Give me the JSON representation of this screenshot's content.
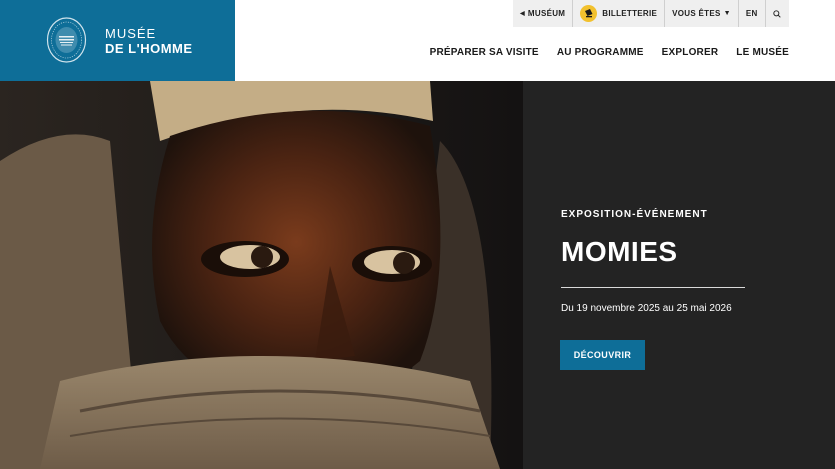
{
  "header": {
    "logo": {
      "line1": "MUSÉE",
      "line2": "DE L'HOMME",
      "seal_icon": "museum-seal-icon",
      "brand_color": "#0e6e98"
    },
    "utility": {
      "museum_link": "MUSÉUM",
      "ticketing": "BILLETTERIE",
      "audience": "VOUS ÊTES",
      "language": "EN",
      "search_icon": "search-icon"
    },
    "nav": [
      {
        "label": "PRÉPARER SA VISITE"
      },
      {
        "label": "AU PROGRAMME"
      },
      {
        "label": "EXPLORER"
      },
      {
        "label": "LE MUSÉE"
      }
    ]
  },
  "hero": {
    "kicker": "EXPOSITION-ÉVÉNEMENT",
    "title": "MOMIES",
    "dates": "Du 19 novembre 2025 au 25 mai 2026",
    "cta": "DÉCOUVRIR",
    "panel_color": "#232323"
  }
}
